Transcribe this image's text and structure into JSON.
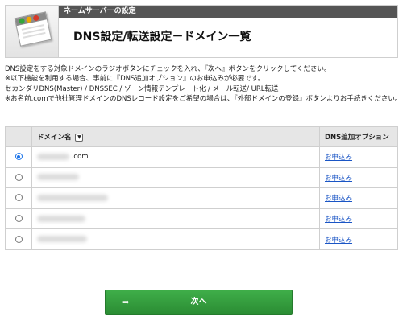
{
  "header": {
    "section_label": "ネームサーバーの設定",
    "title": "DNS設定/転送設定－ドメイン一覧",
    "icon": "browser-window-icon"
  },
  "notes": [
    "DNS設定をする対象ドメインのラジオボタンにチェックを入れ、『次へ』ボタンをクリックしてください。",
    "※以下機能を利用する場合、事前に『DNS追加オプション』のお申込みが必要です。",
    "セカンダリDNS(Master) / DNSSEC / ゾーン情報テンプレート化 / メール転送/ URL転送",
    "※お名前.comで他社管理ドメインのDNSレコード設定をご希望の場合は、『外部ドメインの登録』ボタンよりお手続きください。"
  ],
  "table": {
    "headers": {
      "domain": "ドメイン名",
      "sort_icon": "▼",
      "option": "DNS追加オプション"
    },
    "rows": [
      {
        "selected": true,
        "domain_visible": ".com",
        "option_link": "お申込み"
      },
      {
        "selected": false,
        "domain_visible": "",
        "option_link": "お申込み"
      },
      {
        "selected": false,
        "domain_visible": "",
        "option_link": "お申込み"
      },
      {
        "selected": false,
        "domain_visible": "",
        "option_link": "お申込み"
      },
      {
        "selected": false,
        "domain_visible": "",
        "option_link": "お申込み"
      }
    ]
  },
  "next_button": {
    "arrow": "➡",
    "label": "次へ",
    "color": "#3a9e43"
  }
}
